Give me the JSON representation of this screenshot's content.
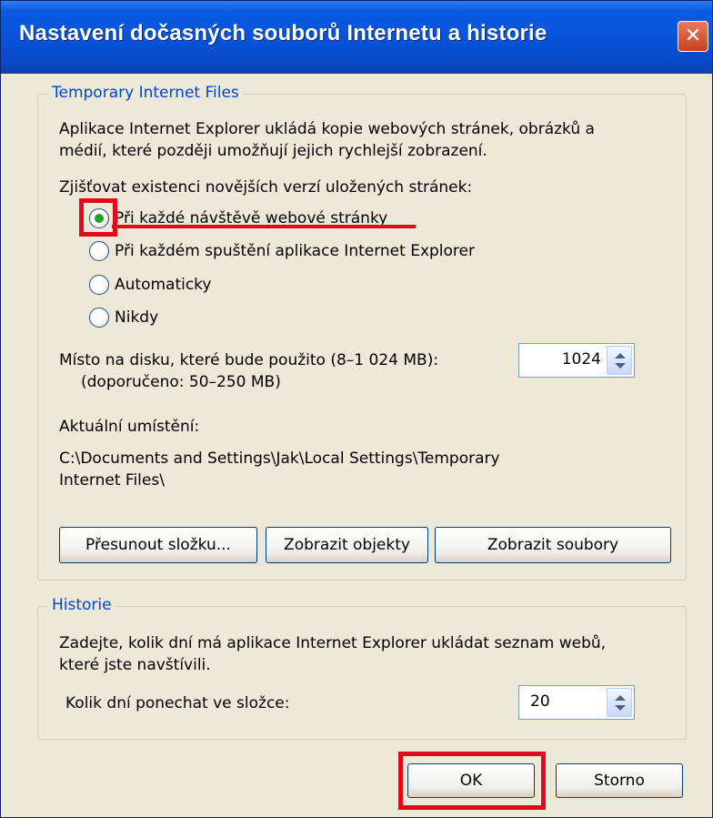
{
  "window": {
    "title": "Nastavení dočasných souborů Internetu a historie",
    "close_glyph": "✕"
  },
  "temp_files": {
    "legend": "Temporary Internet Files",
    "description_line1": "Aplikace Internet Explorer ukládá kopie webových stránek, obrázků a",
    "description_line2": "médií, které později umožňují jejich rychlejší zobrazení.",
    "check_label": "Zjišťovat existenci novějších verzí uložených stránek:",
    "options": [
      {
        "label": "Při každé návštěvě webové stránky",
        "selected": true
      },
      {
        "label": "Při každém spuštění aplikace Internet Explorer",
        "selected": false
      },
      {
        "label": "Automaticky",
        "selected": false
      },
      {
        "label": "Nikdy",
        "selected": false
      }
    ],
    "disk_label_line1": "Místo na disku, které bude použito (8–1 024 MB):",
    "disk_label_line2": "(doporučeno: 50–250 MB)",
    "disk_value": "1024",
    "location_label": "Aktuální umístění:",
    "location_line1": "C:\\Documents and Settings\\Jak\\Local Settings\\Temporary",
    "location_line2": "Internet Files\\",
    "buttons": {
      "move": "Přesunout složku...",
      "view_objects": "Zobrazit objekty",
      "view_files": "Zobrazit soubory"
    }
  },
  "history": {
    "legend": "Historie",
    "description_line1": "Zadejte, kolik dní má aplikace Internet Explorer ukládat seznam webů,",
    "description_line2": "které jste navštívili.",
    "days_label": "Kolik dní ponechat ve složce:",
    "days_value": "20"
  },
  "footer": {
    "ok": "OK",
    "cancel": "Storno"
  },
  "colors": {
    "highlight": "#e00a1a",
    "titlebar": "#0852d8",
    "legend_text": "#0046d5",
    "radio_dot": "#21a121"
  }
}
